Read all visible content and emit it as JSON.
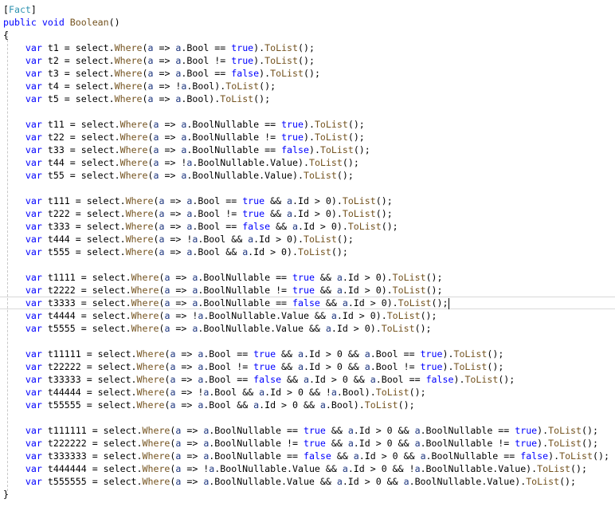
{
  "editor": {
    "current_line": 23,
    "colors": {
      "keyword": "#0000ff",
      "method": "#74531f",
      "parameter": "#1f377f",
      "type": "#2b91af"
    },
    "lines": [
      "[Fact]",
      "public void Boolean()",
      "{",
      "    var t1 = select.Where(a => a.Bool == true).ToList();",
      "    var t2 = select.Where(a => a.Bool != true).ToList();",
      "    var t3 = select.Where(a => a.Bool == false).ToList();",
      "    var t4 = select.Where(a => !a.Bool).ToList();",
      "    var t5 = select.Where(a => a.Bool).ToList();",
      "",
      "    var t11 = select.Where(a => a.BoolNullable == true).ToList();",
      "    var t22 = select.Where(a => a.BoolNullable != true).ToList();",
      "    var t33 = select.Where(a => a.BoolNullable == false).ToList();",
      "    var t44 = select.Where(a => !a.BoolNullable.Value).ToList();",
      "    var t55 = select.Where(a => a.BoolNullable.Value).ToList();",
      "",
      "    var t111 = select.Where(a => a.Bool == true && a.Id > 0).ToList();",
      "    var t222 = select.Where(a => a.Bool != true && a.Id > 0).ToList();",
      "    var t333 = select.Where(a => a.Bool == false && a.Id > 0).ToList();",
      "    var t444 = select.Where(a => !a.Bool && a.Id > 0).ToList();",
      "    var t555 = select.Where(a => a.Bool && a.Id > 0).ToList();",
      "",
      "    var t1111 = select.Where(a => a.BoolNullable == true && a.Id > 0).ToList();",
      "    var t2222 = select.Where(a => a.BoolNullable != true && a.Id > 0).ToList();",
      "    var t3333 = select.Where(a => a.BoolNullable == false && a.Id > 0).ToList();",
      "    var t4444 = select.Where(a => !a.BoolNullable.Value && a.Id > 0).ToList();",
      "    var t5555 = select.Where(a => a.BoolNullable.Value && a.Id > 0).ToList();",
      "",
      "    var t11111 = select.Where(a => a.Bool == true && a.Id > 0 && a.Bool == true).ToList();",
      "    var t22222 = select.Where(a => a.Bool != true && a.Id > 0 && a.Bool != true).ToList();",
      "    var t33333 = select.Where(a => a.Bool == false && a.Id > 0 && a.Bool == false).ToList();",
      "    var t44444 = select.Where(a => !a.Bool && a.Id > 0 && !a.Bool).ToList();",
      "    var t55555 = select.Where(a => a.Bool && a.Id > 0 && a.Bool).ToList();",
      "",
      "    var t111111 = select.Where(a => a.BoolNullable == true && a.Id > 0 && a.BoolNullable == true).ToList();",
      "    var t222222 = select.Where(a => a.BoolNullable != true && a.Id > 0 && a.BoolNullable != true).ToList();",
      "    var t333333 = select.Where(a => a.BoolNullable == false && a.Id > 0 && a.BoolNullable == false).ToList();",
      "    var t444444 = select.Where(a => !a.BoolNullable.Value && a.Id > 0 && !a.BoolNullable.Value).ToList();",
      "    var t555555 = select.Where(a => a.BoolNullable.Value && a.Id > 0 && a.BoolNullable.Value).ToList();",
      "}"
    ]
  }
}
